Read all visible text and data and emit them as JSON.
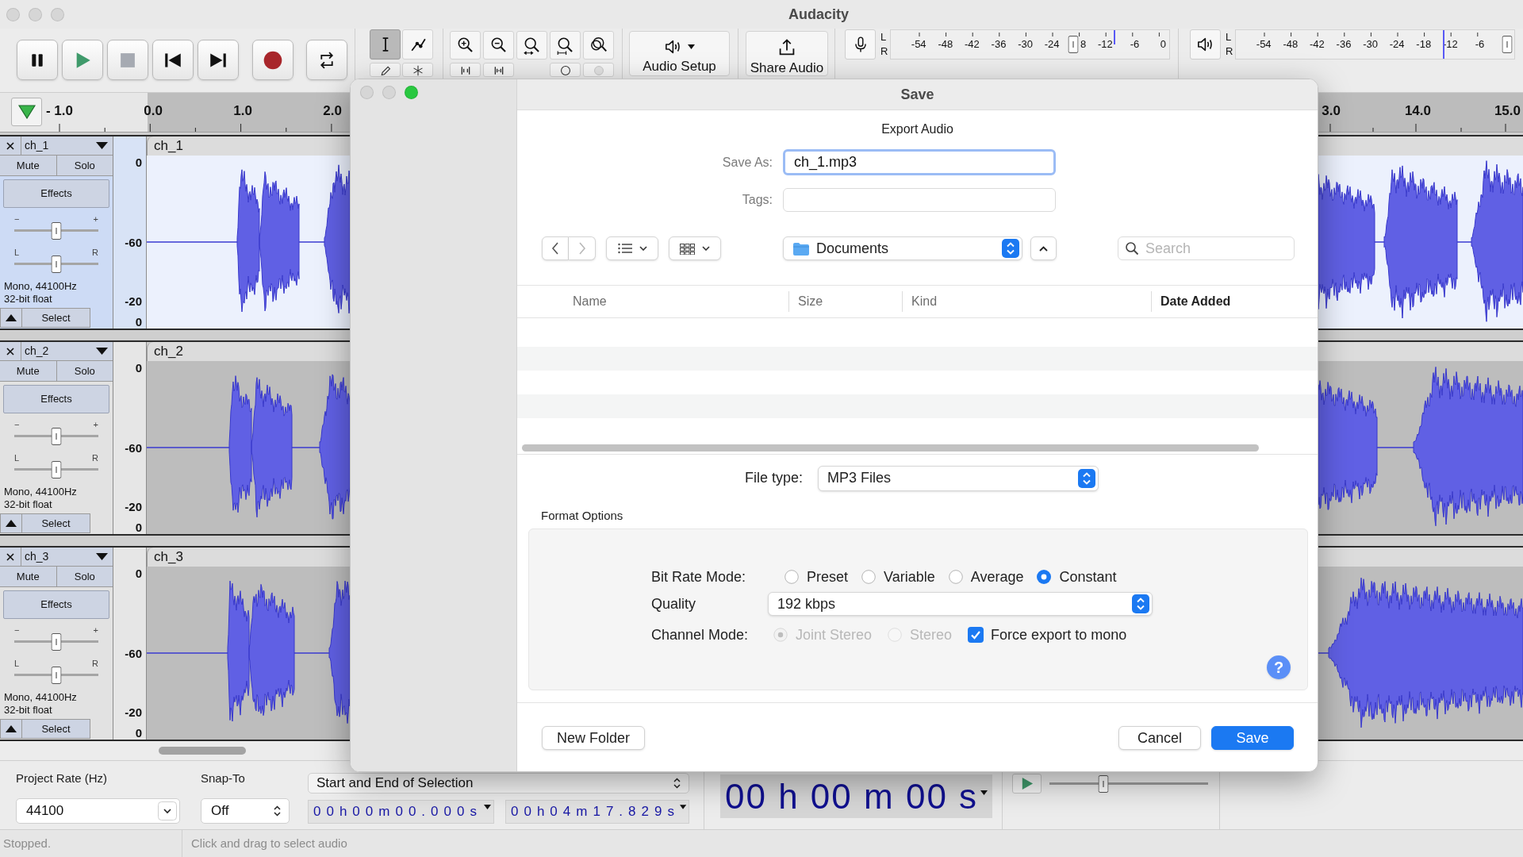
{
  "window": {
    "title": "Audacity",
    "controls": [
      {
        "active": false
      },
      {
        "active": false
      },
      {
        "active": false
      }
    ]
  },
  "tools": [
    {
      "kind": "select",
      "selected": true
    },
    {
      "kind": "envelope",
      "selected": false
    },
    {
      "kind": "draw",
      "selected": false
    },
    {
      "kind": "multi",
      "selected": false
    }
  ],
  "audio_setup": {
    "label": "Audio Setup"
  },
  "share_audio": {
    "label": "Share Audio"
  },
  "recording_meter": {
    "channels": [
      "L",
      "R"
    ],
    "ticks": [
      "-54",
      "-48",
      "-42",
      "-36",
      "-30",
      "-24",
      "8",
      "-12",
      "-6",
      "0"
    ],
    "slider": {
      "level": 0.655
    },
    "peaks": [
      {
        "level": 0.8
      }
    ]
  },
  "playback_meter": {
    "channels": [
      "L",
      "R"
    ],
    "ticks": [
      "-54",
      "-48",
      "-42",
      "-36",
      "-30",
      "-24",
      "-18",
      "-12",
      "-6"
    ],
    "slider": {
      "level": 0.975
    },
    "peaks": [
      {
        "level": 0.745
      },
      {
        "level": 0.745
      }
    ]
  },
  "ruler": {
    "left_labels": [
      "- 1.0",
      "0.0",
      "1.0",
      "2.0"
    ],
    "right_labels": [
      "3.0",
      "14.0",
      "15.0"
    ]
  },
  "tracks": [
    {
      "name": "ch_1",
      "selected": true,
      "mute": "Mute",
      "solo": "Solo",
      "effects": "Effects",
      "gain": {
        "min_label": "−",
        "max_label": "+",
        "level": 0.5
      },
      "pan": {
        "min_label": "L",
        "max_label": "R",
        "level": 0.5
      },
      "info": [
        "Mono, 44100Hz",
        "32-bit float"
      ],
      "select": "Select",
      "scale": [
        "0",
        "-60",
        "-20",
        "0"
      ],
      "clip_name": "ch_1"
    },
    {
      "name": "ch_2",
      "selected": false,
      "mute": "Mute",
      "solo": "Solo",
      "effects": "Effects",
      "gain": {
        "min_label": "−",
        "max_label": "+",
        "level": 0.5
      },
      "pan": {
        "min_label": "L",
        "max_label": "R",
        "level": 0.5
      },
      "info": [
        "Mono, 44100Hz",
        "32-bit float"
      ],
      "select": "Select",
      "scale": [
        "0",
        "-60",
        "-20",
        "0"
      ],
      "clip_name": "ch_2"
    },
    {
      "name": "ch_3",
      "selected": false,
      "mute": "Mute",
      "solo": "Solo",
      "effects": "Effects",
      "gain": {
        "min_label": "−",
        "max_label": "+",
        "level": 0.5
      },
      "pan": {
        "min_label": "L",
        "max_label": "R",
        "level": 0.5
      },
      "info": [
        "Mono, 44100Hz",
        "32-bit float"
      ],
      "select": "Select",
      "scale": [
        "0",
        "-60",
        "-20",
        "0"
      ],
      "clip_name": "ch_3"
    }
  ],
  "selection_bar": {
    "project_rate": {
      "label": "Project Rate (Hz)",
      "value": "44100"
    },
    "snap_to": {
      "label": "Snap-To",
      "value": "Off"
    },
    "selection_mode": {
      "value": "Start and End of Selection"
    },
    "start": {
      "value": "00h00m00.000s"
    },
    "end": {
      "value": "00h04m17.829s"
    }
  },
  "time_display": {
    "value": "00 h 00 m 00 s"
  },
  "play_at_speed": {
    "level": 0.34
  },
  "status_bar": {
    "state": "Stopped.",
    "hint": "Click and drag to select audio"
  },
  "dialog": {
    "controls": [
      {
        "active": false
      },
      {
        "active": false
      },
      {
        "active": true
      }
    ],
    "title": "Save",
    "heading": "Export Audio",
    "save_as": {
      "label": "Save As:",
      "value": "ch_1.mp3"
    },
    "tags": {
      "label": "Tags:"
    },
    "back": {
      "disabled": false
    },
    "forward": {
      "disabled": true
    },
    "location": {
      "value": "Documents"
    },
    "search": {
      "placeholder": "Search"
    },
    "columns": [
      {
        "label": "Name",
        "selected": false
      },
      {
        "label": "Size",
        "selected": false
      },
      {
        "label": "Kind",
        "selected": false
      },
      {
        "label": "Date Added",
        "selected": true
      }
    ],
    "file_type": {
      "label": "File type:",
      "value": "MP3 Files"
    },
    "format_options": {
      "title": "Format Options",
      "bit_rate_mode": {
        "label": "Bit Rate Mode:",
        "options": [
          {
            "label": "Preset",
            "selected": false,
            "disabled": false
          },
          {
            "label": "Variable",
            "selected": false,
            "disabled": false
          },
          {
            "label": "Average",
            "selected": false,
            "disabled": false
          },
          {
            "label": "Constant",
            "selected": true,
            "disabled": false
          }
        ]
      },
      "quality": {
        "label": "Quality",
        "value": "192 kbps"
      },
      "channel_mode": {
        "label": "Channel Mode:",
        "options": [
          {
            "label": "Joint Stereo",
            "selected": true,
            "disabled": true
          },
          {
            "label": "Stereo",
            "selected": false,
            "disabled": true
          }
        ]
      },
      "force_mono": {
        "label": "Force export to mono",
        "checked": true
      },
      "help": {
        "label": "?"
      }
    },
    "buttons": [
      {
        "label": "New Folder",
        "kind": "secondary"
      },
      {
        "label": "Cancel",
        "kind": "secondary"
      },
      {
        "label": "Save",
        "kind": "primary"
      }
    ]
  }
}
